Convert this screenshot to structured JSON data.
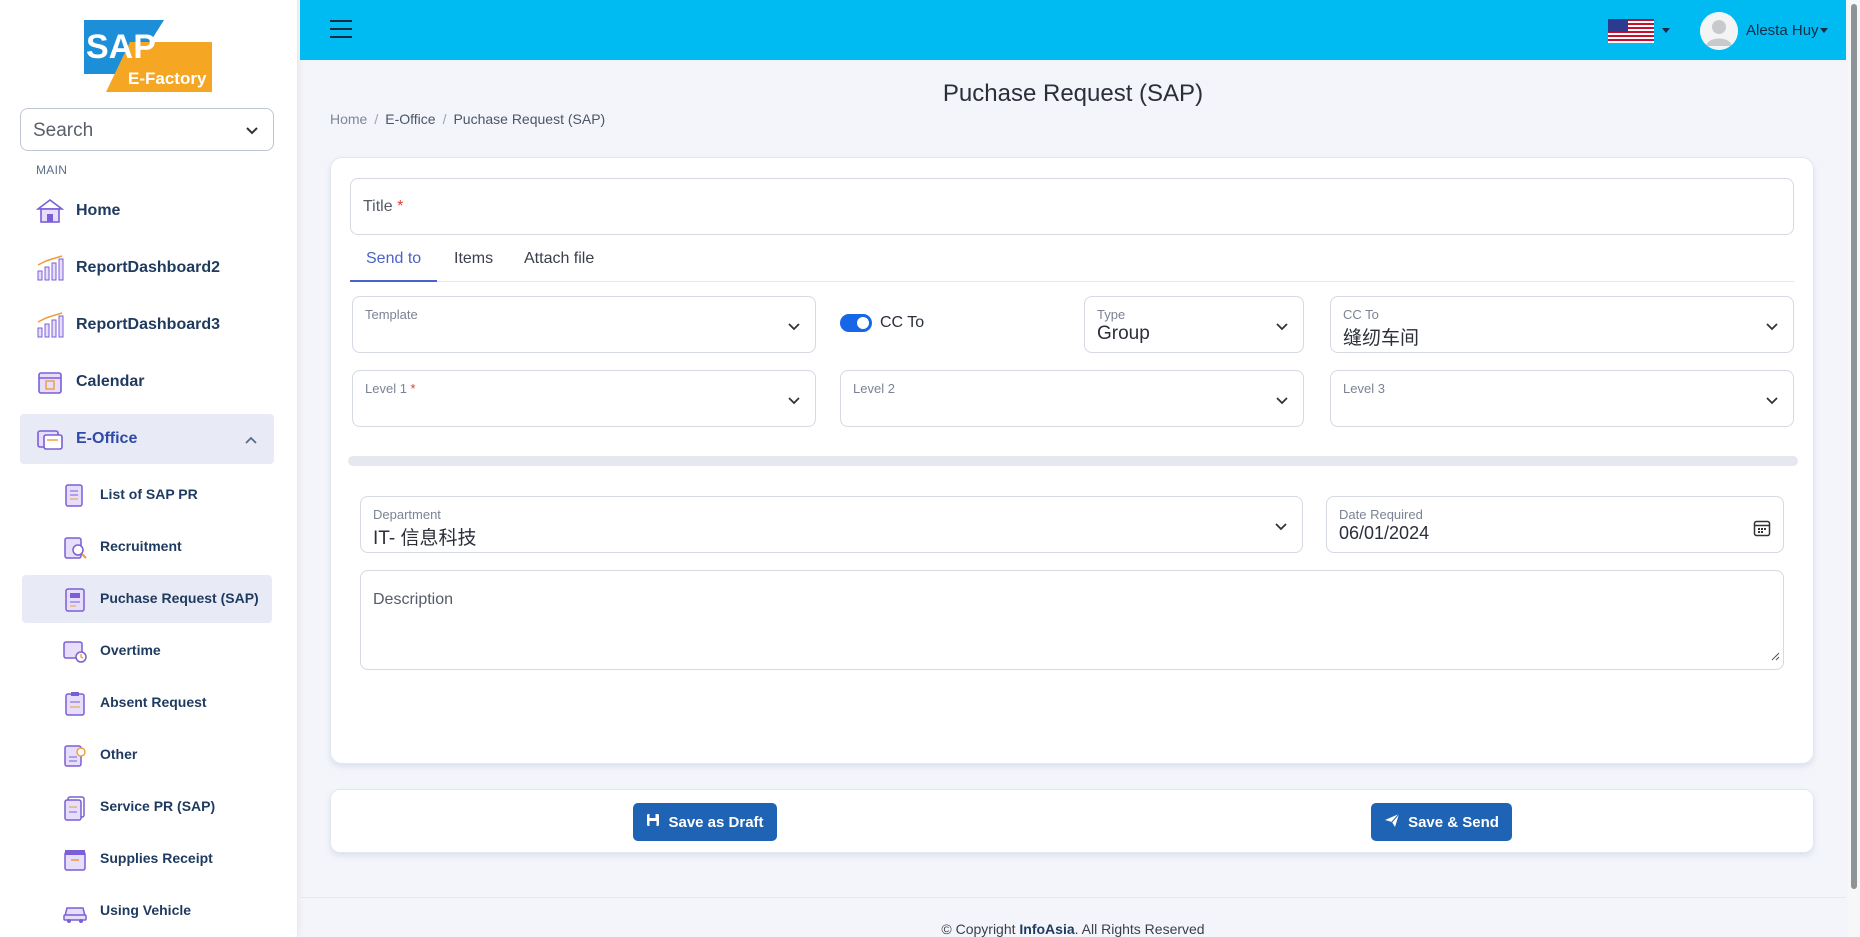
{
  "app": {
    "logo_text": "SAP",
    "logo_sub": "E-Factory"
  },
  "sidebar": {
    "search_placeholder": "Search",
    "section_label": "MAIN",
    "items": [
      {
        "label": "Home",
        "icon": "home-icon"
      },
      {
        "label": "ReportDashboard2",
        "icon": "chart-icon"
      },
      {
        "label": "ReportDashboard3",
        "icon": "chart-icon"
      },
      {
        "label": "Calendar",
        "icon": "calendar-icon"
      },
      {
        "label": "E-Office",
        "icon": "office-icon",
        "expanded": true
      }
    ],
    "sub_items": [
      {
        "label": "List of SAP PR",
        "icon": "list-icon"
      },
      {
        "label": "Recruitment",
        "icon": "recruitment-icon"
      },
      {
        "label": "Puchase Request (SAP)",
        "icon": "purchase-icon",
        "active": true
      },
      {
        "label": "Overtime",
        "icon": "overtime-icon"
      },
      {
        "label": "Absent Request",
        "icon": "clipboard-icon"
      },
      {
        "label": "Other",
        "icon": "other-icon"
      },
      {
        "label": "Service PR (SAP)",
        "icon": "service-icon"
      },
      {
        "label": "Supplies Receipt",
        "icon": "receipt-icon"
      },
      {
        "label": "Using Vehicle",
        "icon": "vehicle-icon"
      }
    ]
  },
  "topbar": {
    "user_name": "Alesta Huy",
    "language_flag": "us-flag-icon"
  },
  "page": {
    "title": "Puchase Request (SAP)",
    "breadcrumb": [
      "Home",
      "E-Office",
      "Puchase Request (SAP)"
    ]
  },
  "form": {
    "title_label": "Title",
    "required_mark": "*",
    "tabs": [
      "Send to",
      "Items",
      "Attach file"
    ],
    "active_tab": "Send to",
    "template_label": "Template",
    "cc_toggle_label": "CC To",
    "cc_toggle_on": true,
    "type_label": "Type",
    "type_value": "Group",
    "cc_to_label": "CC To",
    "cc_to_value": "缝纫车间",
    "level1_label": "Level 1",
    "level2_label": "Level 2",
    "level3_label": "Level 3",
    "department_label": "Department",
    "department_value": "IT- 信息科技",
    "date_label": "Date Required",
    "date_value": "06/01/2024",
    "description_placeholder": "Description"
  },
  "actions": {
    "save_draft": "Save as Draft",
    "save_send": "Save & Send"
  },
  "footer": {
    "prefix": "© Copyright ",
    "company": "InfoAsia",
    "suffix": ". All Rights Reserved"
  },
  "colors": {
    "topbar": "#00baf2",
    "button": "#1f63b4",
    "accent": "#4b63c8",
    "toggle": "#1766e8"
  }
}
